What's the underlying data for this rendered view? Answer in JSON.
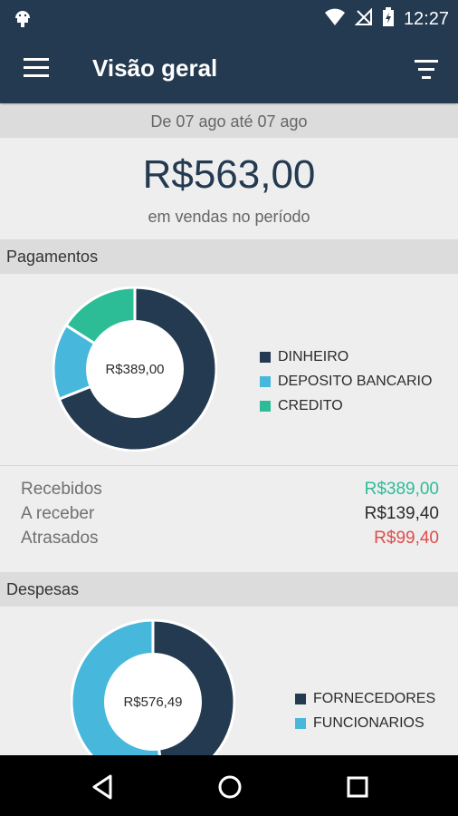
{
  "status_bar": {
    "time": "12:27"
  },
  "app_bar": {
    "title": "Visão geral"
  },
  "period": {
    "range": "De 07 ago até 07 ago"
  },
  "total": {
    "amount": "R$563,00",
    "caption": "em vendas no período"
  },
  "pagamentos": {
    "header": "Pagamentos",
    "center_label": "R$389,00",
    "legend": [
      {
        "label": "DINHEIRO",
        "color": "#243a51"
      },
      {
        "label": "DEPOSITO BANCARIO",
        "color": "#47b7dc"
      },
      {
        "label": "CREDITO",
        "color": "#2dbd96"
      }
    ],
    "chart_data": {
      "type": "pie",
      "categories": [
        "DINHEIRO",
        "DEPOSITO BANCARIO",
        "CREDITO"
      ],
      "values": [
        69,
        15,
        16
      ]
    }
  },
  "summary": {
    "rows": [
      {
        "label": "Recebidos",
        "value": "R$389,00",
        "color": "#2dbd96"
      },
      {
        "label": "A receber",
        "value": "R$139,40",
        "color": "#2b2b2b"
      },
      {
        "label": "Atrasados",
        "value": "R$99,40",
        "color": "#e04b4b"
      }
    ]
  },
  "despesas": {
    "header": "Despesas",
    "center_label": "R$576,49",
    "legend": [
      {
        "label": "FORNECEDORES",
        "color": "#243a51"
      },
      {
        "label": "FUNCIONARIOS",
        "color": "#47b7dc"
      }
    ],
    "chart_data": {
      "type": "pie",
      "categories": [
        "FORNECEDORES",
        "FUNCIONARIOS"
      ],
      "values": [
        48,
        52
      ]
    }
  }
}
